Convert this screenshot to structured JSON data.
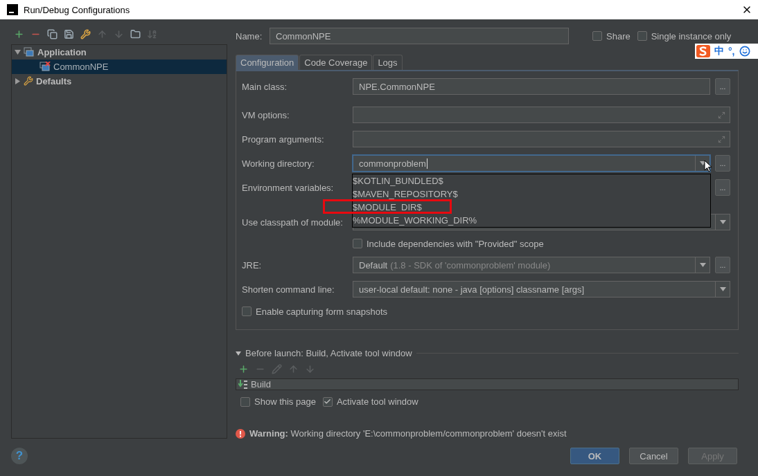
{
  "window": {
    "title": "Run/Debug Configurations"
  },
  "toolbar": [
    {
      "kind": "add",
      "disabled": false
    },
    {
      "kind": "remove",
      "disabled": false
    },
    {
      "kind": "copy",
      "disabled": false
    },
    {
      "kind": "save",
      "disabled": false
    },
    {
      "kind": "wrench",
      "disabled": false
    },
    {
      "kind": "up",
      "disabled": true
    },
    {
      "kind": "down",
      "disabled": true
    },
    {
      "kind": "folder",
      "disabled": false
    },
    {
      "kind": "sort",
      "disabled": true
    }
  ],
  "tree": [
    {
      "label": "Application",
      "kind": "application",
      "expanded": true,
      "selected": false,
      "children": [
        {
          "label": "CommonNPE",
          "kind": "config-error",
          "selected": true
        }
      ]
    },
    {
      "label": "Defaults",
      "kind": "defaults",
      "expanded": false,
      "selected": false
    }
  ],
  "name": {
    "label": "Name:",
    "value": "CommonNPE"
  },
  "options": [
    {
      "label": "Share",
      "checked": false
    },
    {
      "label": "Single instance only",
      "checked": false
    }
  ],
  "ime": {
    "items": [
      "中",
      "°,"
    ]
  },
  "tabs": [
    {
      "label": "Configuration",
      "selected": true
    },
    {
      "label": "Code Coverage",
      "selected": false
    },
    {
      "label": "Logs",
      "selected": false
    }
  ],
  "form": [
    {
      "kind": "text",
      "label": "Main class:",
      "value": "NPE.CommonNPE",
      "focused": false,
      "browse": "..."
    },
    {
      "kind": "expand",
      "label": "VM options:",
      "focused": false
    },
    {
      "kind": "expand",
      "label": "Program arguments:",
      "focused": false
    },
    {
      "kind": "combo",
      "label": "Working directory:",
      "value": "commonproblem",
      "focused": true,
      "browse": "...",
      "suggestions": [
        {
          "label": "$KOTLIN_BUNDLED$",
          "highlighted": false
        },
        {
          "label": "$MAVEN_REPOSITORY$",
          "highlighted": false
        },
        {
          "label": "$MODULE_DIR$",
          "highlighted": true
        },
        {
          "label": "%MODULE_WORKING_DIR%",
          "highlighted": false
        }
      ]
    },
    {
      "kind": "label",
      "label": "Environment variables:",
      "browse": "..."
    },
    {
      "kind": "combo",
      "label": "Use classpath of module:",
      "focused": false
    },
    {
      "kind": "option",
      "label": "Include dependencies with \"Provided\" scope",
      "checked": false
    },
    {
      "kind": "combo",
      "label": "JRE:",
      "value": "Default",
      "hint": "(1.8 - SDK of 'commonproblem' module)",
      "focused": false,
      "browse": "..."
    },
    {
      "kind": "combo",
      "label": "Shorten command line:",
      "value": "user-local default: none - java [options] classname [args]",
      "focused": false
    },
    {
      "kind": "checkbox",
      "label": "Enable capturing form snapshots",
      "checked": false
    }
  ],
  "before_launch": {
    "title": "Before launch: Build, Activate tool window",
    "expanded": true,
    "toolbar": [
      {
        "kind": "add",
        "disabled": false
      },
      {
        "kind": "remove",
        "disabled": true
      },
      {
        "kind": "edit",
        "disabled": true
      },
      {
        "kind": "up",
        "disabled": true
      },
      {
        "kind": "down",
        "disabled": true
      }
    ],
    "tasks": [
      {
        "label": "Build"
      }
    ],
    "options": [
      {
        "label": "Show this page",
        "checked": false
      },
      {
        "label": "Activate tool window",
        "checked": true
      }
    ]
  },
  "warning": "**Warning:** Working directory 'E:\\commonproblem/commonproblem' doesn't exist",
  "help": "?",
  "buttons": [
    {
      "label": "OK",
      "kind": "primary"
    },
    {
      "label": "Cancel",
      "kind": "normal"
    },
    {
      "label": "Apply",
      "kind": "disabled"
    }
  ]
}
